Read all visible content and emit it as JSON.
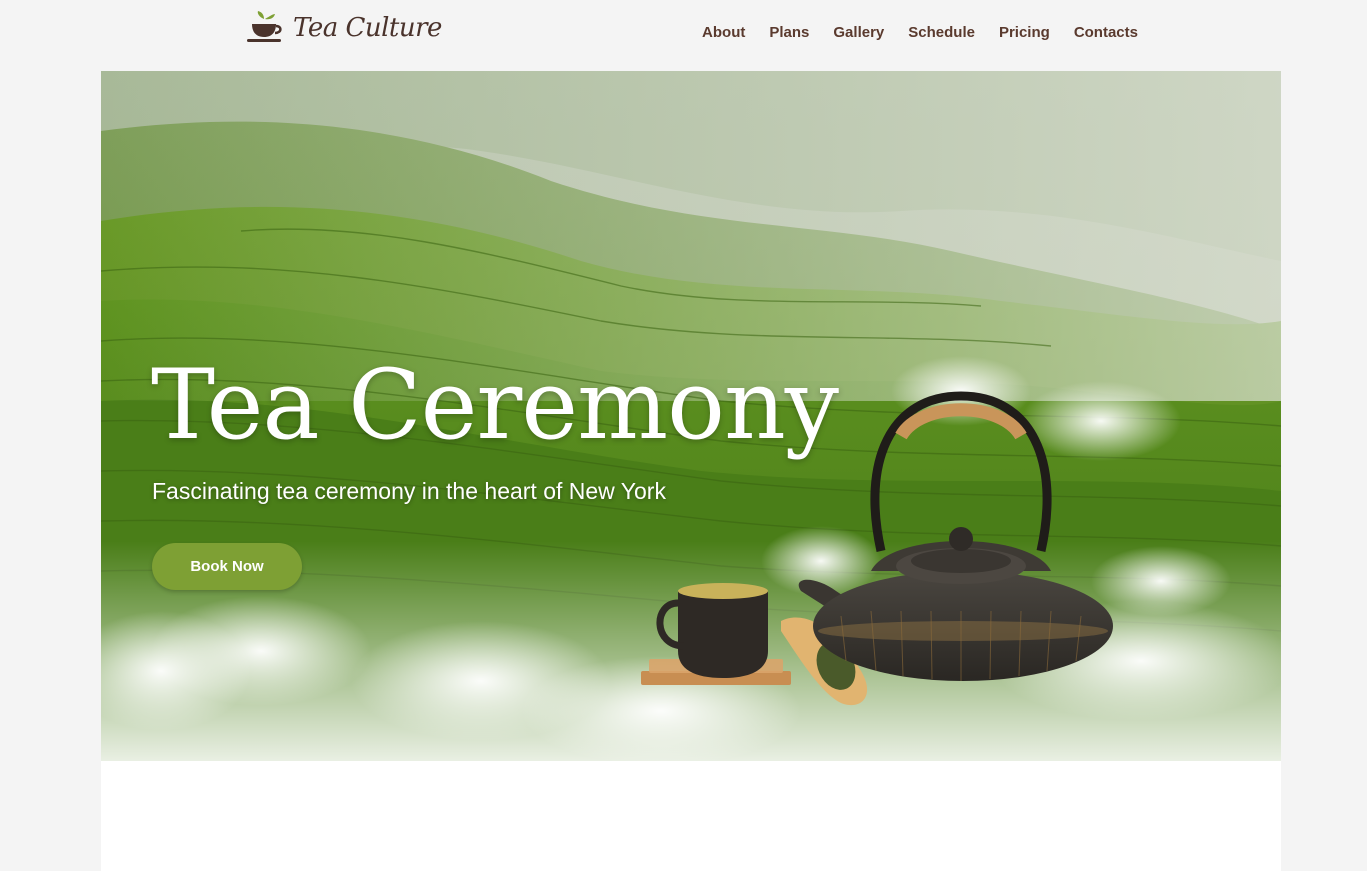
{
  "brand": {
    "name": "Tea Culture",
    "icon": "teacup-leaf-icon"
  },
  "nav": {
    "items": [
      "About",
      "Plans",
      "Gallery",
      "Schedule",
      "Pricing",
      "Contacts"
    ]
  },
  "hero": {
    "title": "Tea Ceremony",
    "subtitle": "Fascinating tea ceremony in the heart of New York",
    "cta_label": "Book Now",
    "image": "tea-plantation-teapot-illustration"
  },
  "colors": {
    "page_bg": "#f4f4f4",
    "brand_brown": "#4a332c",
    "nav_text": "#5a3a2e",
    "cta_green": "#7ea034",
    "hero_text": "#ffffff"
  }
}
